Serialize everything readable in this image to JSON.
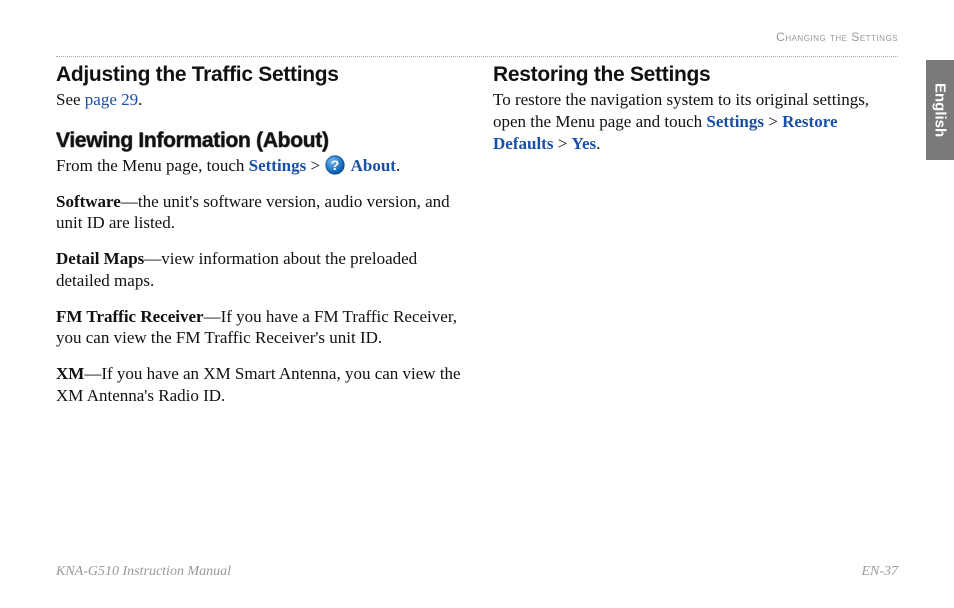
{
  "running_head": "Changing the Settings",
  "side_tab": "English",
  "left": {
    "h_traffic": "Adjusting the Traffic Settings",
    "see_prefix": "See ",
    "see_link": "page 29",
    "see_period": ".",
    "h_about": "Viewing Information (About)",
    "about_prefix": "From the Menu page, touch ",
    "about_settings": "Settings",
    "about_gt": " > ",
    "about_about": "About",
    "about_period": ".",
    "software_label": "Software",
    "software_text": "—the unit's software version, audio version, and unit ID are listed.",
    "detail_label": "Detail Maps",
    "detail_text": "—view information about the preloaded detailed maps.",
    "fm_label": "FM Traffic Receiver",
    "fm_text": "—If you have a FM Traffic Receiver, you can view the FM Traffic Receiver's unit ID.",
    "xm_label": "XM",
    "xm_text": "—If you have an XM Smart Antenna, you can view the XM Antenna's Radio ID."
  },
  "right": {
    "h_restore": "Restoring the Settings",
    "restore_prefix": "To restore the navigation system to its original settings, open the Menu page and touch ",
    "restore_settings": "Settings",
    "restore_gt1": " > ",
    "restore_defaults": "Restore Defaults",
    "restore_gt2": " > ",
    "restore_yes": "Yes",
    "restore_period": "."
  },
  "footer": {
    "left": "KNA-G510 Instruction Manual",
    "right": "EN-37"
  }
}
